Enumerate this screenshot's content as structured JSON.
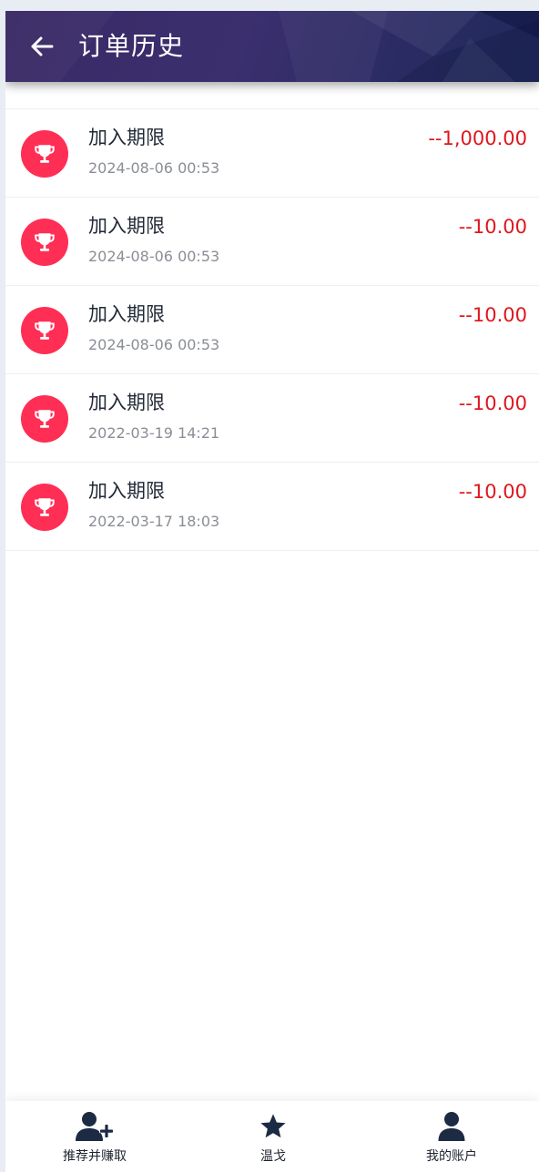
{
  "header": {
    "title": "订单历史",
    "back_icon": "arrow-left-icon"
  },
  "orders": [
    {
      "title": "加入期限",
      "date": "2024-08-06 00:53",
      "amount": "--1,000.00",
      "icon": "trophy-icon"
    },
    {
      "title": "加入期限",
      "date": "2024-08-06 00:53",
      "amount": "--10.00",
      "icon": "trophy-icon"
    },
    {
      "title": "加入期限",
      "date": "2024-08-06 00:53",
      "amount": "--10.00",
      "icon": "trophy-icon"
    },
    {
      "title": "加入期限",
      "date": "2022-03-19 14:21",
      "amount": "--10.00",
      "icon": "trophy-icon"
    },
    {
      "title": "加入期限",
      "date": "2022-03-17 18:03",
      "amount": "--10.00",
      "icon": "trophy-icon"
    }
  ],
  "bottom_nav": [
    {
      "label": "推荐并赚取",
      "icon": "user-plus-icon"
    },
    {
      "label": "温戈",
      "icon": "star-icon"
    },
    {
      "label": "我的账户",
      "icon": "user-icon"
    }
  ],
  "colors": {
    "accent_red": "#ff2e55",
    "amount_red": "#e0161c",
    "header_dark": "#2d2a63",
    "nav_icon": "#1c2a44"
  }
}
